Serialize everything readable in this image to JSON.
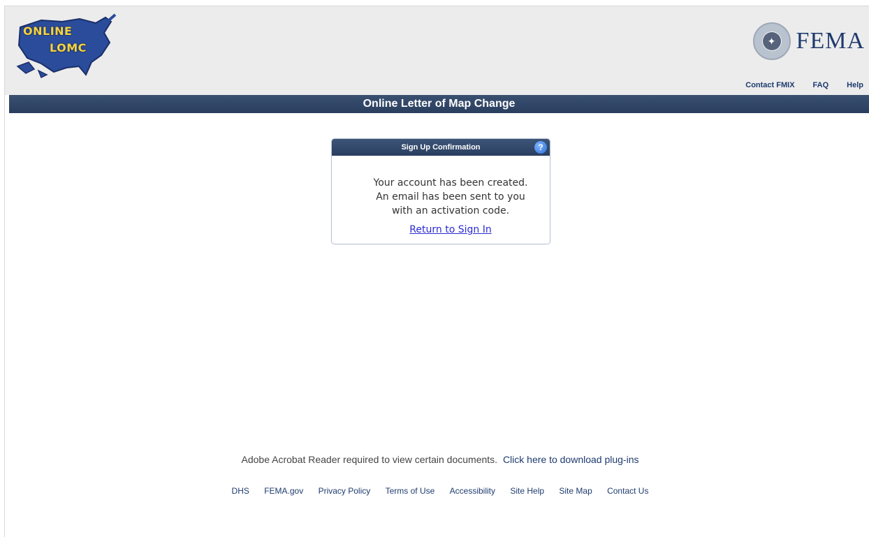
{
  "header": {
    "logo_line1": "ONLINE",
    "logo_line2": "LOMC",
    "agency": "FEMA",
    "links": [
      "Contact FMIX",
      "FAQ",
      "Help"
    ]
  },
  "title_bar": "Online Letter of Map Change",
  "dialog": {
    "title": "Sign Up Confirmation",
    "help_icon": "question-icon",
    "message_lines": [
      "Your account has been created.",
      "An email has been sent to you",
      "with an activation code."
    ],
    "link": "Return to Sign In"
  },
  "acrobat": {
    "text": "Adobe Acrobat Reader required to view certain documents.",
    "link": "Click here to download plug-ins"
  },
  "footer_links": [
    "DHS",
    "FEMA.gov",
    "Privacy Policy",
    "Terms of Use",
    "Accessibility",
    "Site Help",
    "Site Map",
    "Contact Us"
  ],
  "colors": {
    "title_bar": "#2f4566",
    "header_bg": "#ececec",
    "link": "#2b2bd6",
    "nav_text": "#1e3b6f"
  }
}
